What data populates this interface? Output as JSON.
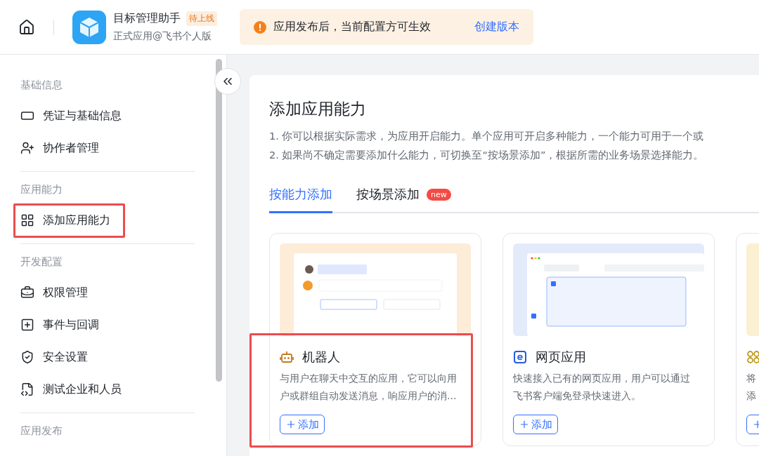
{
  "header": {
    "app": {
      "name": "目标管理助手",
      "status_badge": "待上线",
      "subtitle": "正式应用@飞书个人版"
    },
    "notice": {
      "text": "应用发布后，当前配置方可生效",
      "link": "创建版本"
    }
  },
  "sidebar": {
    "sections": [
      {
        "title": "基础信息",
        "items": [
          {
            "label": "凭证与基础信息",
            "highlighted": false
          },
          {
            "label": "协作者管理",
            "highlighted": false
          }
        ]
      },
      {
        "title": "应用能力",
        "items": [
          {
            "label": "添加应用能力",
            "highlighted": true
          }
        ]
      },
      {
        "title": "开发配置",
        "items": [
          {
            "label": "权限管理",
            "highlighted": false
          },
          {
            "label": "事件与回调",
            "highlighted": false
          },
          {
            "label": "安全设置",
            "highlighted": false
          },
          {
            "label": "测试企业和人员",
            "highlighted": false
          }
        ]
      },
      {
        "title": "应用发布"
      }
    ]
  },
  "content": {
    "title": "添加应用能力",
    "notes": [
      "1. 你可以根据实际需求，为应用开启能力。单个应用可开启多种能力，一个能力可用于一个或",
      "2. 如果尚不确定需要添加什么能力，可切换至“按场景添加”，根据所需的业务场景选择能力。"
    ],
    "tabs": [
      {
        "label": "按能力添加",
        "selected": true
      },
      {
        "label": "按场景添加",
        "selected": false,
        "badge": "new"
      }
    ],
    "cards": [
      {
        "title": "机器人",
        "description_lines": [
          "与用户在聊天中交互的应用，它可以向用",
          "户或群组自动发送消息，响应用户的消..."
        ],
        "button": "添加",
        "highlighted": true
      },
      {
        "title": "网页应用",
        "description_lines": [
          "快速接入已有的网页应用，用户可以通过",
          "飞书客户端免登录快速进入。"
        ],
        "button": "添加",
        "highlighted": false
      },
      {
        "description_lines": [
          "将",
          "添"
        ],
        "highlighted": false
      }
    ]
  }
}
